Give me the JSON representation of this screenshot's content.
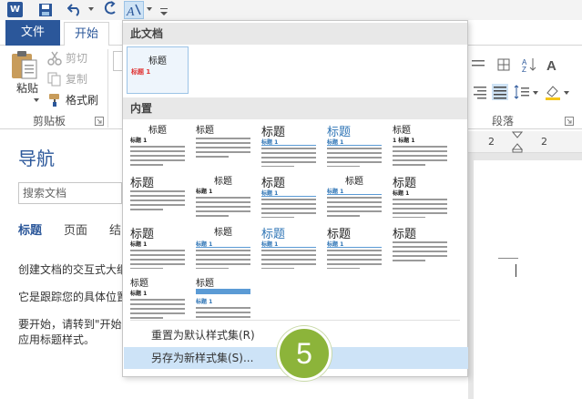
{
  "app": {
    "logo_letter": "W"
  },
  "tabs": {
    "file": "文件",
    "home": "开始"
  },
  "clipboard": {
    "paste": "粘贴",
    "cut": "剪切",
    "copy": "复制",
    "format_painter": "格式刷",
    "group_label": "剪贴板"
  },
  "paragraph": {
    "group_label": "段落"
  },
  "ruler": {
    "marks": [
      "2",
      "2"
    ]
  },
  "nav": {
    "title": "导航",
    "search_placeholder": "搜索文档",
    "tabs": [
      "标题",
      "页面",
      "结"
    ],
    "lines": [
      "创建文档的交互式大纲",
      "它是跟踪您的具体位置",
      "要开始，请转到\"开始",
      "应用标题样式。"
    ]
  },
  "gallery": {
    "this_document": "此文档",
    "builtin": "内置",
    "current_thumb": {
      "title": "标题",
      "heading": "标题 1"
    },
    "builtin_thumbs": [
      {
        "title": "标题",
        "heading": "标题 1"
      },
      {
        "title": "标题",
        "heading": ""
      },
      {
        "title": "标题",
        "heading": "标题 1"
      },
      {
        "title": "标题",
        "heading": "标题 1"
      },
      {
        "title": "标题",
        "heading": "1 标题 1"
      },
      {
        "title": "标题",
        "heading": ""
      },
      {
        "title": "标题",
        "heading": "标题 1"
      },
      {
        "title": "标题",
        "heading": "标题 1"
      },
      {
        "title": "标题",
        "heading": "标题 1"
      },
      {
        "title": "标题",
        "heading": "标题 1"
      },
      {
        "title": "标题",
        "heading": "标题 1"
      },
      {
        "title": "标题",
        "heading": "标题 1"
      },
      {
        "title": "标题",
        "heading": "标题 1"
      },
      {
        "title": "标题",
        "heading": "标题 1"
      },
      {
        "title": "标题",
        "heading": ""
      },
      {
        "title": "标题",
        "heading": "标题 1"
      },
      {
        "title": "标题",
        "heading": "标题 1"
      }
    ],
    "menu": {
      "reset": "重置为默认样式集(R)",
      "save_as": "另存为新样式集(S)..."
    }
  },
  "step_badge": "5",
  "colors": {
    "brand_blue": "#2b579a",
    "heading_red": "#e03030",
    "hover_blue": "#cde3f7",
    "badge_green": "#8cb43a"
  }
}
